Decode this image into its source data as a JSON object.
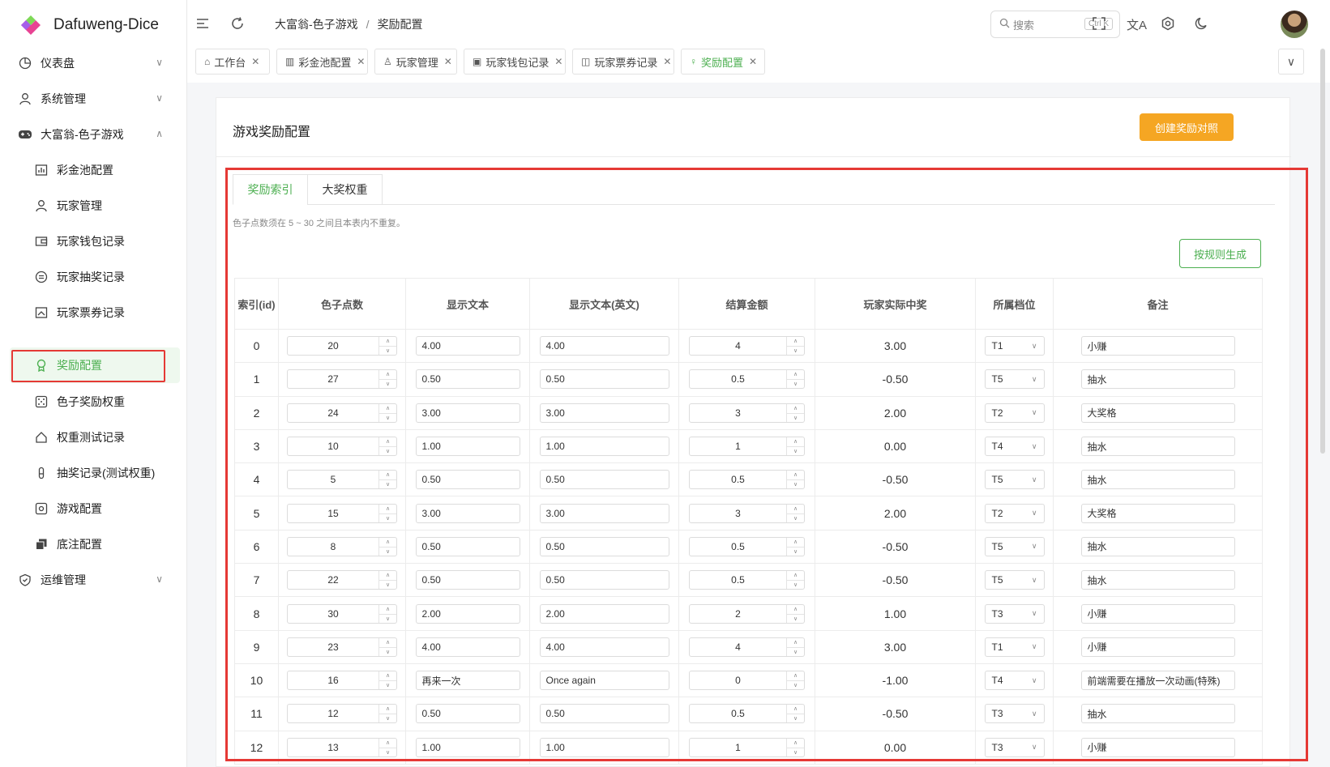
{
  "app": {
    "name": "Dafuweng-Dice"
  },
  "sidebar": {
    "items": [
      {
        "label": "仪表盘",
        "icon": "dashboard-icon"
      },
      {
        "label": "系统管理",
        "icon": "user-icon"
      },
      {
        "label": "大富翁-色子游戏",
        "icon": "gamepad-icon"
      },
      {
        "label": "彩金池配置",
        "icon": "chart-icon"
      },
      {
        "label": "玩家管理",
        "icon": "user-icon"
      },
      {
        "label": "玩家钱包记录",
        "icon": "wallet-icon"
      },
      {
        "label": "玩家抽奖记录",
        "icon": "coin-icon"
      },
      {
        "label": "玩家票券记录",
        "icon": "ticket-icon"
      },
      {
        "label": "奖励配置",
        "icon": "award-icon"
      },
      {
        "label": "色子奖励权重",
        "icon": "dice-icon"
      },
      {
        "label": "权重测试记录",
        "icon": "home-icon"
      },
      {
        "label": "抽奖记录(测试权重)",
        "icon": "flask-icon"
      },
      {
        "label": "游戏配置",
        "icon": "settings-icon"
      },
      {
        "label": "底注配置",
        "icon": "layers-icon"
      },
      {
        "label": "运维管理",
        "icon": "shield-icon"
      }
    ]
  },
  "header": {
    "breadcrumb": [
      "大富翁-色子游戏",
      "奖励配置"
    ],
    "breadcrumb_sep": "/",
    "search_placeholder": "搜索",
    "search_shortcut": "Ctrl K"
  },
  "tabs": [
    {
      "label": "工作台"
    },
    {
      "label": "彩金池配置"
    },
    {
      "label": "玩家管理"
    },
    {
      "label": "玩家钱包记录"
    },
    {
      "label": "玩家票券记录"
    },
    {
      "label": "奖励配置",
      "active": true
    }
  ],
  "main": {
    "title": "游戏奖励配置",
    "create_button": "创建奖励对照",
    "inner_tabs": [
      "奖励索引",
      "大奖权重"
    ],
    "hint": "色子点数须在 5 ~ 30 之间且本表内不重复。",
    "generate_button": "按规则生成",
    "columns": [
      "索引(id)",
      "色子点数",
      "显示文本",
      "显示文本(英文)",
      "结算金额",
      "玩家实际中奖",
      "所属档位",
      "备注"
    ],
    "rows": [
      {
        "id": "0",
        "dice": "20",
        "text": "4.00",
        "text_en": "4.00",
        "amount": "4",
        "actual": "3.00",
        "tier": "T1",
        "note": "小赚"
      },
      {
        "id": "1",
        "dice": "27",
        "text": "0.50",
        "text_en": "0.50",
        "amount": "0.5",
        "actual": "-0.50",
        "tier": "T5",
        "note": "抽水"
      },
      {
        "id": "2",
        "dice": "24",
        "text": "3.00",
        "text_en": "3.00",
        "amount": "3",
        "actual": "2.00",
        "tier": "T2",
        "note": "大奖格"
      },
      {
        "id": "3",
        "dice": "10",
        "text": "1.00",
        "text_en": "1.00",
        "amount": "1",
        "actual": "0.00",
        "tier": "T4",
        "note": "抽水"
      },
      {
        "id": "4",
        "dice": "5",
        "text": "0.50",
        "text_en": "0.50",
        "amount": "0.5",
        "actual": "-0.50",
        "tier": "T5",
        "note": "抽水"
      },
      {
        "id": "5",
        "dice": "15",
        "text": "3.00",
        "text_en": "3.00",
        "amount": "3",
        "actual": "2.00",
        "tier": "T2",
        "note": "大奖格"
      },
      {
        "id": "6",
        "dice": "8",
        "text": "0.50",
        "text_en": "0.50",
        "amount": "0.5",
        "actual": "-0.50",
        "tier": "T5",
        "note": "抽水"
      },
      {
        "id": "7",
        "dice": "22",
        "text": "0.50",
        "text_en": "0.50",
        "amount": "0.5",
        "actual": "-0.50",
        "tier": "T5",
        "note": "抽水"
      },
      {
        "id": "8",
        "dice": "30",
        "text": "2.00",
        "text_en": "2.00",
        "amount": "2",
        "actual": "1.00",
        "tier": "T3",
        "note": "小赚"
      },
      {
        "id": "9",
        "dice": "23",
        "text": "4.00",
        "text_en": "4.00",
        "amount": "4",
        "actual": "3.00",
        "tier": "T1",
        "note": "小赚"
      },
      {
        "id": "10",
        "dice": "16",
        "text": "再来一次",
        "text_en": "Once again",
        "amount": "0",
        "actual": "-1.00",
        "tier": "T4",
        "note": "前端需要在播放一次动画(特殊)"
      },
      {
        "id": "11",
        "dice": "12",
        "text": "0.50",
        "text_en": "0.50",
        "amount": "0.5",
        "actual": "-0.50",
        "tier": "T3",
        "note": "抽水"
      },
      {
        "id": "12",
        "dice": "13",
        "text": "1.00",
        "text_en": "1.00",
        "amount": "1",
        "actual": "0.00",
        "tier": "T3",
        "note": "小赚"
      }
    ]
  },
  "colors": {
    "accent": "#4caf50",
    "create_button": "#f5a623",
    "highlight": "#e53935"
  }
}
